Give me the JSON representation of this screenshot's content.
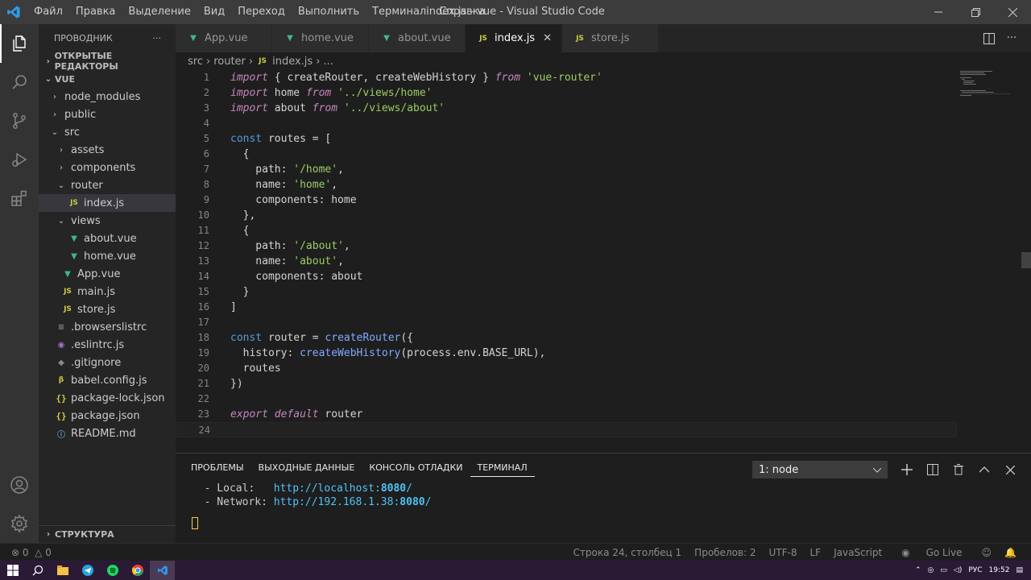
{
  "window": {
    "title": "index.js - vue - Visual Studio Code",
    "menu": [
      "Файл",
      "Правка",
      "Выделение",
      "Вид",
      "Переход",
      "Выполнить",
      "Терминал",
      "Справка"
    ]
  },
  "sidebar": {
    "title": "ПРОВОДНИК",
    "more": "···",
    "open_editors": "ОТКРЫТЫЕ РЕДАКТОРЫ",
    "project": "VUE",
    "outline": "СТРУКТУРА",
    "tree": [
      {
        "label": "node_modules",
        "type": "folder",
        "depth": 1,
        "open": false,
        "icon_glyph": "›"
      },
      {
        "label": "public",
        "type": "folder",
        "depth": 1,
        "open": false,
        "icon_glyph": "›"
      },
      {
        "label": "src",
        "type": "folder",
        "depth": 1,
        "open": true,
        "icon_glyph": "⌄"
      },
      {
        "label": "assets",
        "type": "folder",
        "depth": 2,
        "open": false,
        "icon_glyph": "›"
      },
      {
        "label": "components",
        "type": "folder",
        "depth": 2,
        "open": false,
        "icon_glyph": "›"
      },
      {
        "label": "router",
        "type": "folder",
        "depth": 2,
        "open": true,
        "icon_glyph": "⌄"
      },
      {
        "label": "index.js",
        "type": "js",
        "depth": 3,
        "selected": true,
        "icon_glyph": "JS"
      },
      {
        "label": "views",
        "type": "folder",
        "depth": 2,
        "open": true,
        "icon_glyph": "⌄"
      },
      {
        "label": "about.vue",
        "type": "vue",
        "depth": 3,
        "icon_glyph": "▼"
      },
      {
        "label": "home.vue",
        "type": "vue",
        "depth": 3,
        "icon_glyph": "▼"
      },
      {
        "label": "App.vue",
        "type": "vue",
        "depth": 2,
        "icon_glyph": "▼"
      },
      {
        "label": "main.js",
        "type": "js",
        "depth": 2,
        "icon_glyph": "JS"
      },
      {
        "label": "store.js",
        "type": "js",
        "depth": 2,
        "icon_glyph": "JS"
      },
      {
        "label": ".browserslistrc",
        "type": "plain",
        "depth": 1,
        "icon_glyph": "≡"
      },
      {
        "label": ".eslintrc.js",
        "type": "eslint",
        "depth": 1,
        "icon_glyph": "◉"
      },
      {
        "label": ".gitignore",
        "type": "plain",
        "depth": 1,
        "icon_glyph": "◆"
      },
      {
        "label": "babel.config.js",
        "type": "babel",
        "depth": 1,
        "icon_glyph": "β"
      },
      {
        "label": "package-lock.json",
        "type": "json",
        "depth": 1,
        "icon_glyph": "{}"
      },
      {
        "label": "package.json",
        "type": "json",
        "depth": 1,
        "icon_glyph": "{}"
      },
      {
        "label": "README.md",
        "type": "info",
        "depth": 1,
        "icon_glyph": "ⓘ"
      }
    ]
  },
  "tabs": [
    {
      "label": "App.vue",
      "type": "vue",
      "icon_glyph": "▼"
    },
    {
      "label": "home.vue",
      "type": "vue",
      "icon_glyph": "▼"
    },
    {
      "label": "about.vue",
      "type": "vue",
      "icon_glyph": "▼"
    },
    {
      "label": "index.js",
      "type": "js",
      "active": true,
      "icon_glyph": "JS"
    },
    {
      "label": "store.js",
      "type": "js",
      "icon_glyph": "JS"
    }
  ],
  "breadcrumb": {
    "items": [
      "src",
      "router",
      "index.js",
      "..."
    ],
    "sep": "›",
    "js_glyph": "JS"
  },
  "code": [
    {
      "n": "1",
      "tokens": [
        [
          "k",
          "import"
        ],
        [
          "p",
          " { createRouter, createWebHistory } "
        ],
        [
          "k",
          "from"
        ],
        [
          "p",
          " "
        ],
        [
          "s2",
          "'vue-router'"
        ]
      ]
    },
    {
      "n": "2",
      "tokens": [
        [
          "k",
          "import"
        ],
        [
          "p",
          " home "
        ],
        [
          "k",
          "from"
        ],
        [
          "p",
          " "
        ],
        [
          "s2",
          "'../views/home'"
        ]
      ]
    },
    {
      "n": "3",
      "tokens": [
        [
          "k",
          "import"
        ],
        [
          "p",
          " about "
        ],
        [
          "k",
          "from"
        ],
        [
          "p",
          " "
        ],
        [
          "s2",
          "'../views/about'"
        ]
      ]
    },
    {
      "n": "4",
      "tokens": []
    },
    {
      "n": "5",
      "tokens": [
        [
          "kb",
          "const"
        ],
        [
          "p",
          " routes = ["
        ]
      ]
    },
    {
      "n": "6",
      "tokens": [
        [
          "p",
          "  {"
        ]
      ]
    },
    {
      "n": "7",
      "tokens": [
        [
          "p",
          "    path: "
        ],
        [
          "s2",
          "'/home'"
        ],
        [
          "p",
          ","
        ]
      ]
    },
    {
      "n": "8",
      "tokens": [
        [
          "p",
          "    name: "
        ],
        [
          "s2",
          "'home'"
        ],
        [
          "p",
          ","
        ]
      ]
    },
    {
      "n": "9",
      "tokens": [
        [
          "p",
          "    components: home"
        ]
      ]
    },
    {
      "n": "10",
      "tokens": [
        [
          "p",
          "  },"
        ]
      ]
    },
    {
      "n": "11",
      "tokens": [
        [
          "p",
          "  {"
        ]
      ]
    },
    {
      "n": "12",
      "tokens": [
        [
          "p",
          "    path: "
        ],
        [
          "s2",
          "'/about'"
        ],
        [
          "p",
          ","
        ]
      ]
    },
    {
      "n": "13",
      "tokens": [
        [
          "p",
          "    name: "
        ],
        [
          "s2",
          "'about'"
        ],
        [
          "p",
          ","
        ]
      ]
    },
    {
      "n": "14",
      "tokens": [
        [
          "p",
          "    components: about"
        ]
      ]
    },
    {
      "n": "15",
      "tokens": [
        [
          "p",
          "  }"
        ]
      ]
    },
    {
      "n": "16",
      "tokens": [
        [
          "p",
          "]"
        ]
      ]
    },
    {
      "n": "17",
      "tokens": []
    },
    {
      "n": "18",
      "tokens": [
        [
          "kb",
          "const"
        ],
        [
          "p",
          " router = "
        ],
        [
          "f",
          "createRouter"
        ],
        [
          "p",
          "({"
        ]
      ]
    },
    {
      "n": "19",
      "tokens": [
        [
          "p",
          "  history: "
        ],
        [
          "f",
          "createWebHistory"
        ],
        [
          "p",
          "(process.env.BASE_URL),"
        ]
      ]
    },
    {
      "n": "20",
      "tokens": [
        [
          "p",
          "  routes"
        ]
      ]
    },
    {
      "n": "21",
      "tokens": [
        [
          "p",
          "})"
        ]
      ]
    },
    {
      "n": "22",
      "tokens": []
    },
    {
      "n": "23",
      "tokens": [
        [
          "k",
          "export"
        ],
        [
          "p",
          " "
        ],
        [
          "k",
          "default"
        ],
        [
          "p",
          " router"
        ]
      ]
    },
    {
      "n": "24",
      "tokens": [],
      "current": true
    }
  ],
  "panel": {
    "tabs": [
      "ПРОБЛЕМЫ",
      "ВЫХОДНЫЕ ДАННЫЕ",
      "КОНСОЛЬ ОТЛАДКИ",
      "ТЕРМИНАЛ"
    ],
    "active_tab": 3,
    "terminal_select": "1: node",
    "lines": [
      {
        "label": "  - Local:   ",
        "url": "http://localhost:",
        "port": "8080",
        "tail": "/"
      },
      {
        "label": "  - Network: ",
        "url": "http://192.168.1.38:",
        "port": "8080",
        "tail": "/"
      }
    ]
  },
  "status": {
    "errors": "0",
    "warnings": "0",
    "position": "Строка 24, столбец 1",
    "spaces": "Пробелов: 2",
    "encoding": "UTF-8",
    "eol": "LF",
    "language": "JavaScript",
    "golive": "Go Live"
  },
  "taskbar": {
    "lang": "РУС",
    "time": "19:52"
  }
}
